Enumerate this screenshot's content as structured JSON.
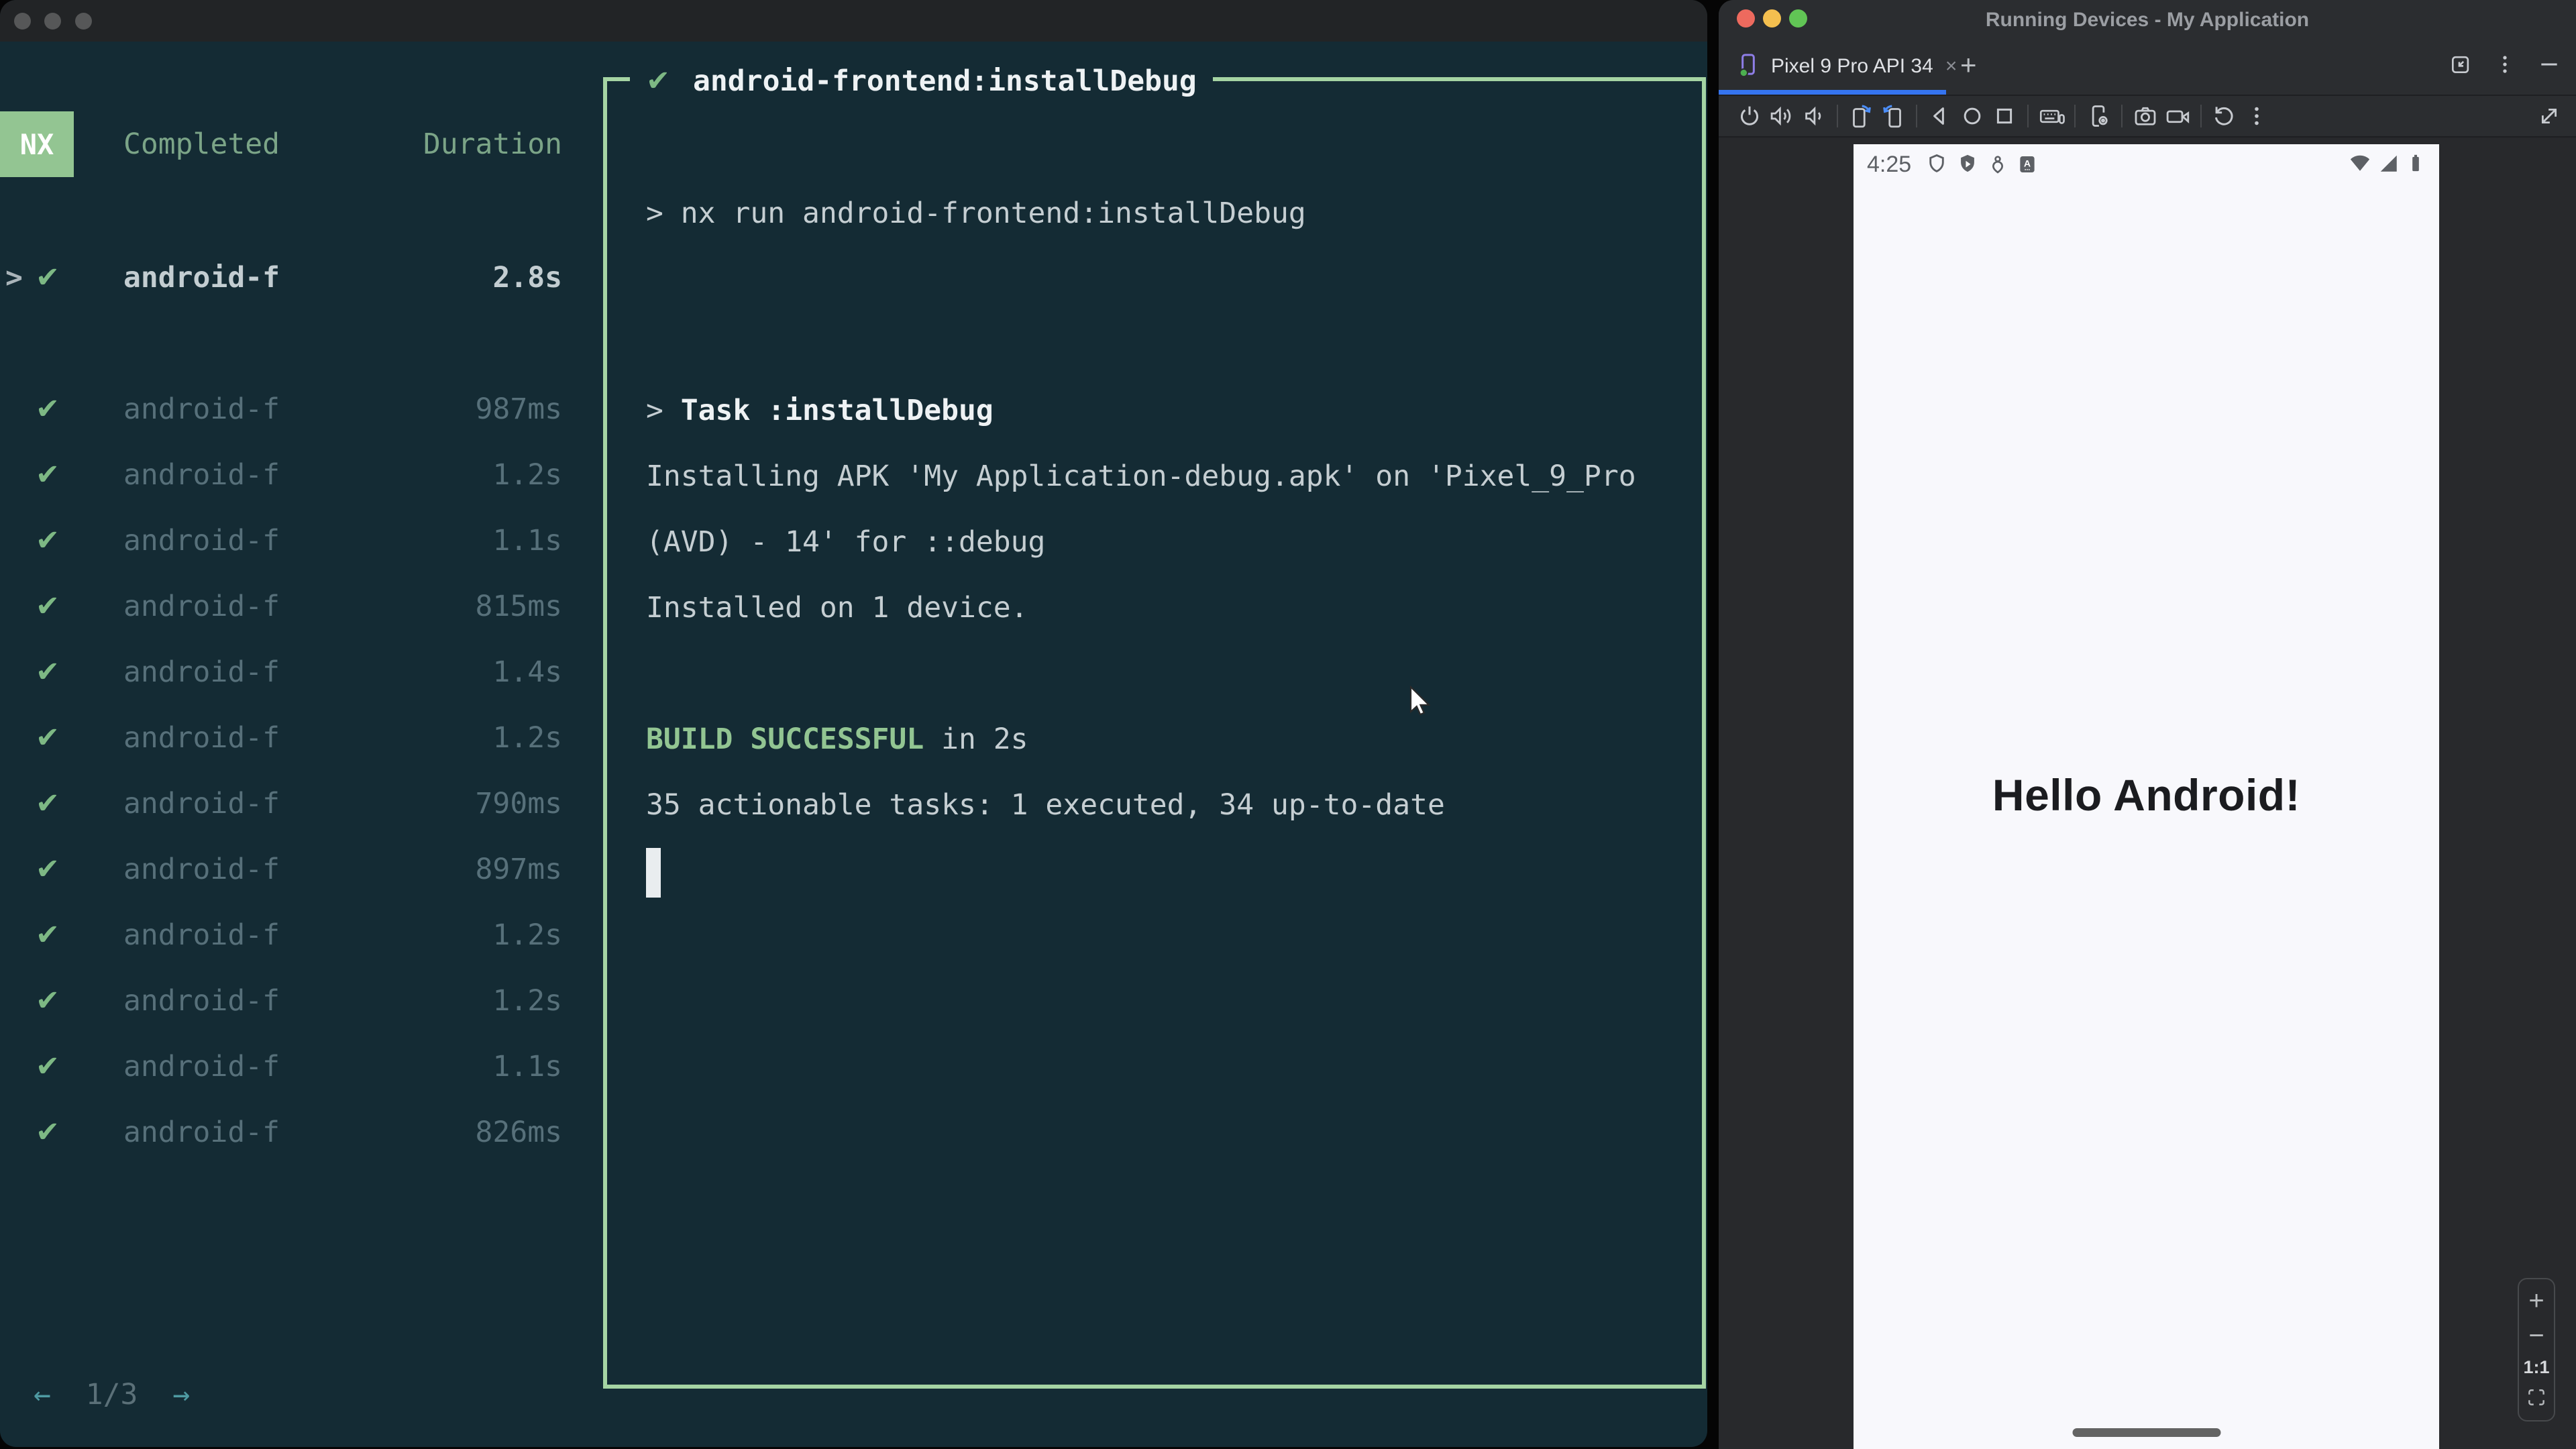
{
  "left_window": {
    "sidebar": {
      "logo": "NX",
      "columns": {
        "completed": "Completed",
        "duration": "Duration"
      },
      "check_glyph": "✔",
      "selected_task": {
        "prefix": ">",
        "check": "✔",
        "name": "android-f",
        "duration": "2.8s"
      },
      "tasks": [
        {
          "name": "android-f",
          "duration": "987ms"
        },
        {
          "name": "android-f",
          "duration": "1.2s"
        },
        {
          "name": "android-f",
          "duration": "1.1s"
        },
        {
          "name": "android-f",
          "duration": "815ms"
        },
        {
          "name": "android-f",
          "duration": "1.4s"
        },
        {
          "name": "android-f",
          "duration": "1.2s"
        },
        {
          "name": "android-f",
          "duration": "790ms"
        },
        {
          "name": "android-f",
          "duration": "897ms"
        },
        {
          "name": "android-f",
          "duration": "1.2s"
        },
        {
          "name": "android-f",
          "duration": "1.2s"
        },
        {
          "name": "android-f",
          "duration": "1.1s"
        },
        {
          "name": "android-f",
          "duration": "826ms"
        }
      ],
      "pagination": {
        "prev": "←",
        "label": "1/3",
        "next": "→"
      }
    },
    "output": {
      "title_check": "✔",
      "title": "android-frontend:installDebug",
      "cmd_line": "> nx run android-frontend:installDebug",
      "task_prefix": "> ",
      "task_name": "Task :installDebug",
      "install_line1": "Installing APK 'My Application-debug.apk' on 'Pixel_9_Pro",
      "install_line2": "(AVD) - 14' for ::debug",
      "installed_line": "Installed on 1 device.",
      "build_status": "BUILD SUCCESSFUL",
      "build_time": " in 2s",
      "summary_line": "35 actionable tasks: 1 executed, 34 up-to-date"
    }
  },
  "right_window": {
    "titlebar": {
      "title": "Running Devices - My Application"
    },
    "tab": {
      "label": "Pixel 9 Pro API 34",
      "close": "×",
      "new_tab": "+"
    },
    "toolbar_icons": [
      "power-icon",
      "volume-up-icon",
      "volume-down-icon",
      "rotate-left-icon",
      "rotate-right-icon",
      "back-icon",
      "home-icon",
      "overview-icon",
      "keyboard-icon",
      "device-settings-icon",
      "screenshot-icon",
      "screen-record-icon",
      "restart-icon",
      "more-options-icon",
      "resize-icon"
    ],
    "emulator": {
      "status_time": "4:25",
      "status_icons": [
        "shield-icon",
        "shield-play-icon",
        "location-icon",
        "app-a-icon",
        "wifi-icon",
        "signal-icon",
        "battery-icon"
      ],
      "hello_text": "Hello Android!",
      "zoom": {
        "zoom_in": "+",
        "zoom_out": "−",
        "actual_size": "1:1"
      }
    }
  },
  "colors": {
    "accent_green": "#93c592",
    "border_green": "#a5d4a3",
    "teal_bg": "#142b34",
    "tab_accent_blue": "#3574f0",
    "traffic_red": "#ed6a5e",
    "traffic_yellow": "#f4bf4f",
    "traffic_green": "#61c555"
  }
}
